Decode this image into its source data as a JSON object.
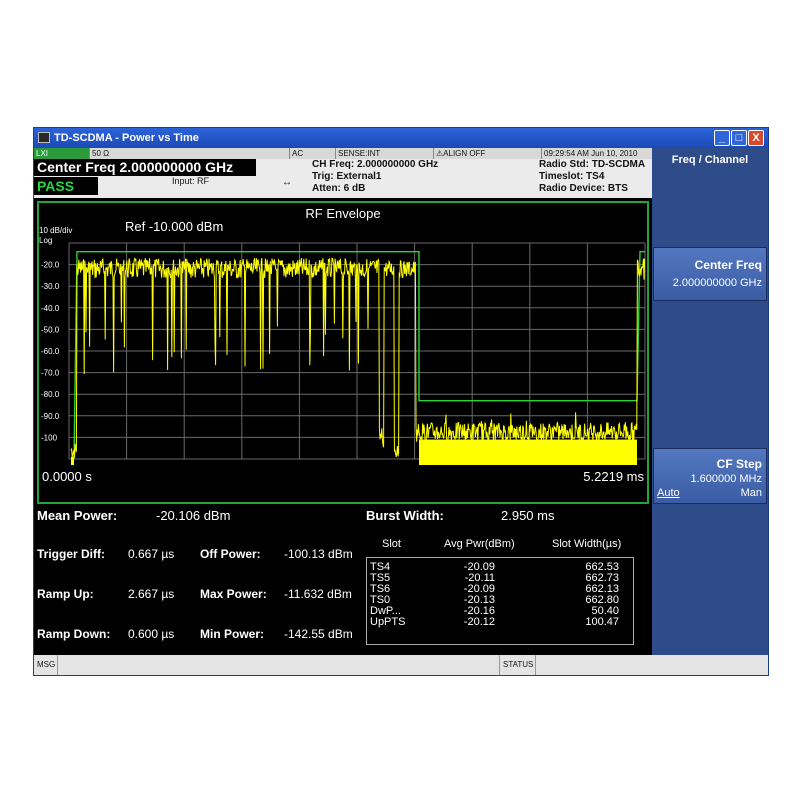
{
  "window": {
    "title": "TD-SCDMA - Power vs Time",
    "min_label": "_",
    "max_label": "□",
    "close_label": "X"
  },
  "status_row": {
    "logo": "LXI",
    "impedance": "50 Ω",
    "coupling": "AC",
    "sense": "SENSE:INT",
    "align": "⚠ALIGN OFF",
    "timestamp": "09:29:54 AM Jun 10, 2010"
  },
  "header": {
    "center_freq": "Center Freq  2.000000000 GHz",
    "verdict": "PASS",
    "input": "Input: RF",
    "ch_freq": "CH Freq: 2.000000000 GHz",
    "trig": "Trig: External1",
    "atten": "Atten: 6 dB",
    "radio_std": "Radio Std: TD-SCDMA",
    "timeslot": "Timeslot: TS4",
    "radio_device": "Radio Device: BTS"
  },
  "plot": {
    "title": "RF Envelope",
    "ref": "Ref -10.000 dBm",
    "scale": "10 dB/div",
    "mode": "Log",
    "y_ticks": [
      "-20.0",
      "-30.0",
      "-40.0",
      "-50.0",
      "-60.0",
      "-70.0",
      "-80.0",
      "-90.0",
      "-100"
    ],
    "x_start": "0.0000 s",
    "x_end": "5.2219 ms",
    "trace_color": "#ffff00",
    "mask_color": "#2bd43b",
    "grid_color": "#6a6a6a"
  },
  "measurements": {
    "mean_power_label": "Mean Power:",
    "mean_power_value": "-20.106 dBm",
    "burst_width_label": "Burst Width:",
    "burst_width_value": "2.950 ms",
    "trigger_diff_label": "Trigger Diff:",
    "trigger_diff_value": "0.667 µs",
    "ramp_up_label": "Ramp Up:",
    "ramp_up_value": "2.667 µs",
    "ramp_down_label": "Ramp Down:",
    "ramp_down_value": "0.600 µs",
    "off_power_label": "Off Power:",
    "off_power_value": "-100.13 dBm",
    "max_power_label": "Max Power:",
    "max_power_value": "-11.632 dBm",
    "min_power_label": "Min Power:",
    "min_power_value": "-142.55 dBm"
  },
  "slot_table": {
    "headers": [
      "Slot",
      "Avg Pwr(dBm)",
      "Slot Width(µs)"
    ],
    "rows": [
      [
        "TS4",
        "-20.09",
        "662.53"
      ],
      [
        "TS5",
        "-20.11",
        "662.73"
      ],
      [
        "TS6",
        "-20.09",
        "662.13"
      ],
      [
        "TS0",
        "-20.13",
        "662.80"
      ],
      [
        "DwP...",
        "-20.16",
        "50.40"
      ],
      [
        "UpPTS",
        "-20.12",
        "100.47"
      ]
    ]
  },
  "softkeys": {
    "menu_title": "Freq / Channel",
    "center_freq_label": "Center Freq",
    "center_freq_value": "2.000000000 GHz",
    "cf_step_label": "CF Step",
    "cf_step_value": "1.600000 MHz",
    "cf_step_auto": "Auto",
    "cf_step_man": "Man"
  },
  "bottom_bar": {
    "msg": "MSG",
    "status": "STATUS"
  }
}
